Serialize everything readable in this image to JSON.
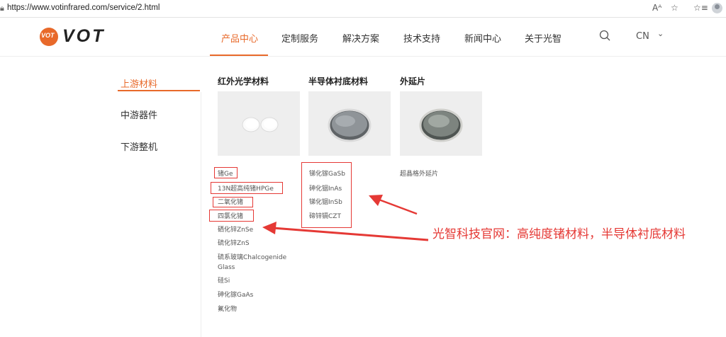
{
  "browser": {
    "url": "https://www.votinfrared.com/service/2.html",
    "icons": [
      "lock-icon",
      "read-aloud-icon",
      "favorite-star-icon",
      "favorites-list-icon",
      "profile-avatar"
    ]
  },
  "header": {
    "logo_mark": "VOT",
    "logo_text": "VOT",
    "nav": [
      "产品中心",
      "定制服务",
      "解决方案",
      "技术支持",
      "新闻中心",
      "关于光智"
    ],
    "active_nav": 0,
    "lang": "CN"
  },
  "sidebar": {
    "items": [
      "上游材料",
      "中游器件",
      "下游整机"
    ],
    "active": 0
  },
  "columns": [
    {
      "title": "红外光学材料",
      "items": [
        "锗Ge",
        "13N超高纯锗HPGe",
        "二氧化锗",
        "四氯化锗",
        "硒化锌ZnSe",
        "硫化锌ZnS",
        "硫系玻璃Chalcogenide Glass",
        "硅Si",
        "砷化镓GaAs",
        "氟化物"
      ]
    },
    {
      "title": "半导体衬底材料",
      "items": [
        "锑化镓GaSb",
        "砷化铟InAs",
        "锑化铟InSb",
        "碲锌镉CZT"
      ]
    },
    {
      "title": "外延片",
      "items": [
        "超晶格外延片"
      ]
    }
  ],
  "annotation": "光智科技官网：高纯度锗材料，半导体衬底材料",
  "colors": {
    "accent": "#e8692a",
    "annotation_red": "#e53935"
  }
}
